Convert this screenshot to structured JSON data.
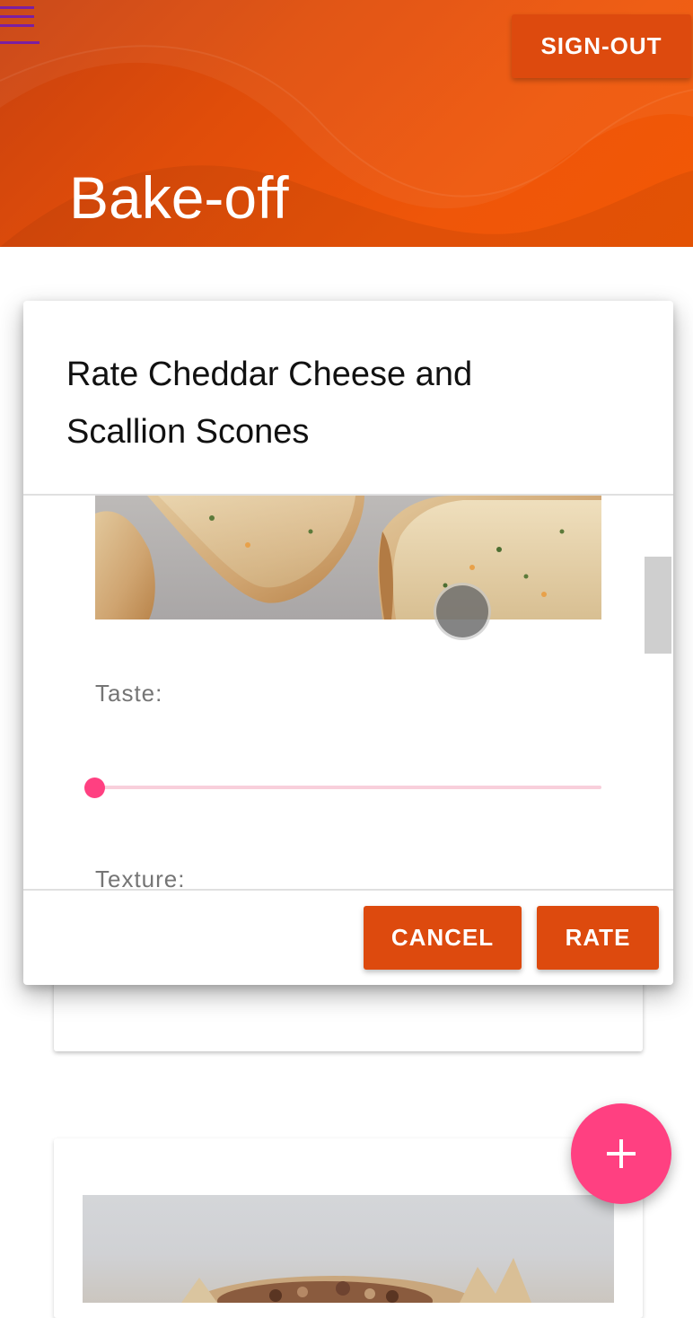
{
  "header": {
    "title": "Bake-off",
    "signout_label": "SIGN-OUT",
    "menu_icon": "hamburger-menu-icon"
  },
  "dialog": {
    "title": "Rate Cheddar Cheese and Scallion Scones",
    "image_subject": "Cheddar Cheese and Scallion Scones photo",
    "taste_label": "Taste:",
    "taste_value": 0,
    "texture_label": "Texture:",
    "cancel_label": "CANCEL",
    "rate_label": "RATE"
  },
  "fab": {
    "icon": "plus-icon"
  },
  "colors": {
    "primary": "#dd4a0e",
    "header_gradient_start": "#c8410f",
    "header_gradient_end": "#f25805",
    "accent": "#ff4081",
    "menu_icon": "#7b1fa2"
  }
}
